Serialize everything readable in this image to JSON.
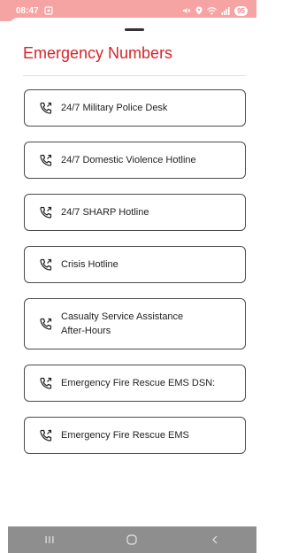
{
  "status": {
    "time": "08:47",
    "battery": "95"
  },
  "sheet": {
    "title": "Emergency Numbers"
  },
  "items": [
    {
      "label": "24/7 Military Police Desk"
    },
    {
      "label": "24/7 Domestic Violence Hotline"
    },
    {
      "label": "24/7 SHARP Hotline"
    },
    {
      "label": "Crisis Hotline"
    },
    {
      "label": "Casualty Service Assistance After-Hours"
    },
    {
      "label": "Emergency Fire Rescue EMS DSN:"
    },
    {
      "label": "Emergency Fire Rescue EMS"
    }
  ],
  "icons": {
    "item_icon": "phone-outgoing-icon",
    "nav_recent": "recent-apps-icon",
    "nav_home": "home-icon",
    "nav_back": "back-icon"
  },
  "colors": {
    "status_bar": "#f6a3a3",
    "title": "#d8232a",
    "nav_bar": "#8e8e8e"
  }
}
